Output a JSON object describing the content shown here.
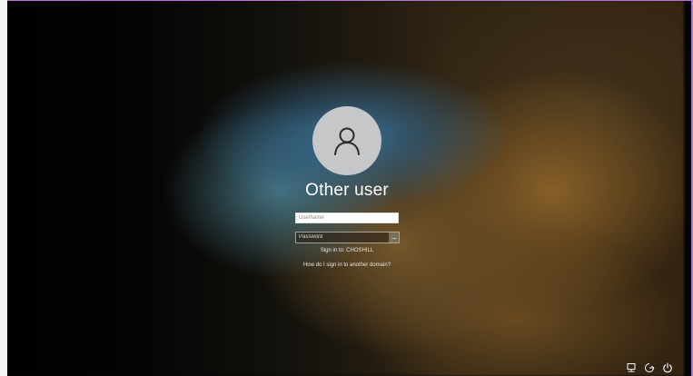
{
  "login": {
    "user_name": "Other user",
    "username_placeholder": "Username",
    "password_placeholder": "Password",
    "submit_glyph": "→",
    "sign_in_to": "Sign in to: CHOSHILL",
    "domain_link": "How do I sign in to another domain?"
  },
  "icons": {
    "avatar": "user-avatar-icon",
    "network": "network-icon",
    "ease_of_access": "ease-of-access-icon",
    "power": "power-icon"
  },
  "colors": {
    "avatar_bg": "#c5c7c9",
    "text": "#ffffff",
    "accent_border": "#b774d6"
  }
}
